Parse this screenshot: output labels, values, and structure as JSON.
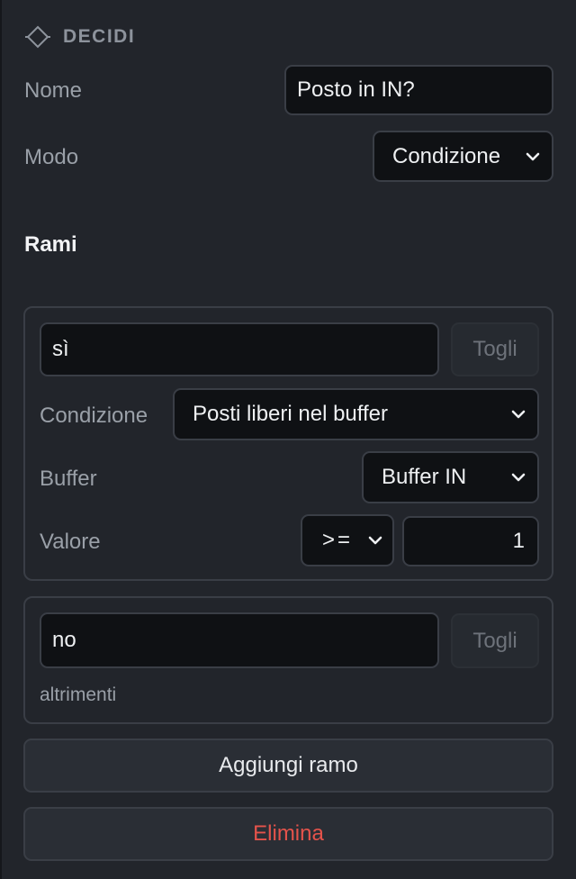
{
  "panel": {
    "title": "DECIDI",
    "icon": "diamond-node-icon"
  },
  "fields": {
    "name_label": "Nome",
    "name_value": "Posto in IN?",
    "mode_label": "Modo",
    "mode_value": "Condizione"
  },
  "branches_title": "Rami",
  "branches": [
    {
      "name": "sì",
      "remove_label": "Togli",
      "condition_label": "Condizione",
      "condition_value": "Posti liberi nel buffer",
      "buffer_label": "Buffer",
      "buffer_value": "Buffer IN",
      "value_label": "Valore",
      "operator": ">=",
      "value": "1"
    },
    {
      "name": "no",
      "remove_label": "Togli",
      "otherwise_text": "altrimenti"
    }
  ],
  "actions": {
    "add_branch_label": "Aggiungi ramo",
    "delete_label": "Elimina"
  },
  "colors": {
    "background": "#22252b",
    "input_bg": "#0f1114",
    "border": "#3a3e46",
    "danger": "#e5534b",
    "muted_text": "#9aa0a8"
  }
}
